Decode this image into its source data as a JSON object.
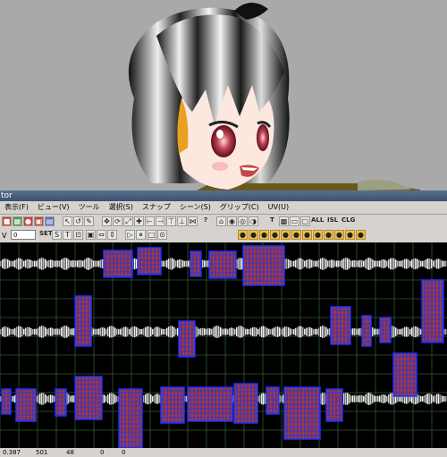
{
  "window": {
    "title": "tor"
  },
  "menu": [
    {
      "label": "表示(F)"
    },
    {
      "label": "ビュー(V)"
    },
    {
      "label": "ツール"
    },
    {
      "label": "選択(S)"
    },
    {
      "label": "スナップ"
    },
    {
      "label": "シーン(S)"
    },
    {
      "label": "グリップ(C)"
    },
    {
      "label": "UV(U)"
    }
  ],
  "toolbar": {
    "v_label": "V",
    "v_value": "0",
    "set_label": "SET",
    "help_label": "?",
    "t_label": "T",
    "all_label": "ALL",
    "isl_label": "ISL",
    "clg_label": "CLG"
  },
  "statusbar": {
    "coord": "0.387",
    "value2": "501",
    "value3": "48",
    "value4": "0",
    "value5": "0"
  },
  "colors": {
    "viewport_bg": "#a9a9a9",
    "toolbar_bg": "#d6d3ce",
    "uv_bg": "#000000",
    "grid": "#2e5c2e",
    "uv_edges": "#1a30ff",
    "uv_faces": "#a83a2a"
  }
}
